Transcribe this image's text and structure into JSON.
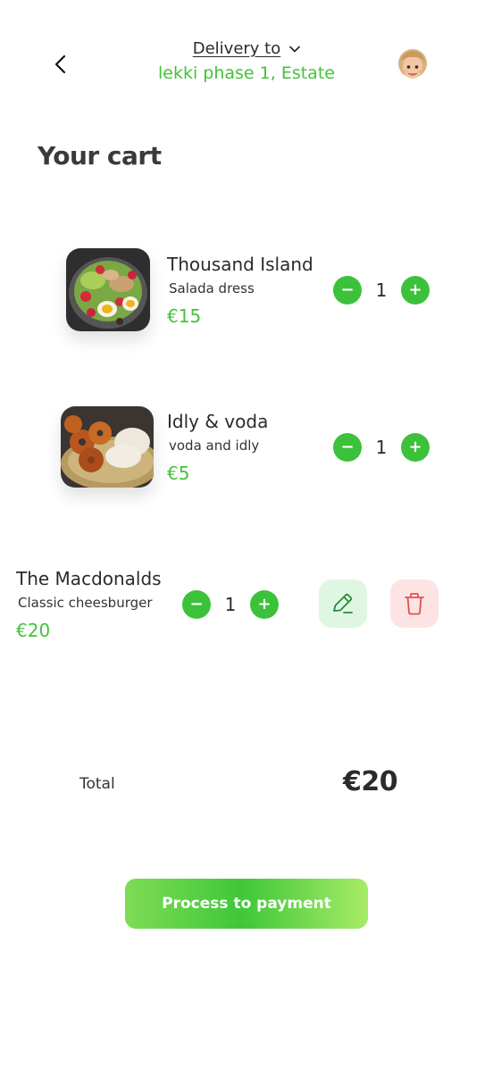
{
  "header": {
    "back_icon": "chevron-left-icon",
    "delivery_label": "Delivery to",
    "delivery_address": "lekki phase 1, Estate",
    "dropdown_icon": "chevron-down-icon",
    "avatar_icon": "memoji-avatar"
  },
  "page_title": "Your cart",
  "cart": {
    "items": [
      {
        "name": "Thousand Island",
        "description": "Salada dress",
        "price": "€15",
        "quantity": "1",
        "image": "salad-bowl-image"
      },
      {
        "name": "Idly & voda",
        "description": "voda and idly",
        "price": "€5",
        "quantity": "1",
        "image": "idly-vada-plate-image"
      },
      {
        "name": "The Macdonalds",
        "description": "Classic cheesburger",
        "price": "€20",
        "quantity": "1",
        "edit_icon": "pencil-icon",
        "delete_icon": "trash-icon"
      }
    ],
    "minus_symbol": "−",
    "plus_symbol": "+"
  },
  "summary": {
    "total_label": "Total",
    "total_value": "€20"
  },
  "payment_button": "Process to payment",
  "colors": {
    "accent_green": "#44c13a",
    "edit_bg": "#dff7e2",
    "delete_bg": "#fde4e4",
    "delete_icon": "#e84c4c",
    "edit_icon": "#2a8a3a"
  }
}
